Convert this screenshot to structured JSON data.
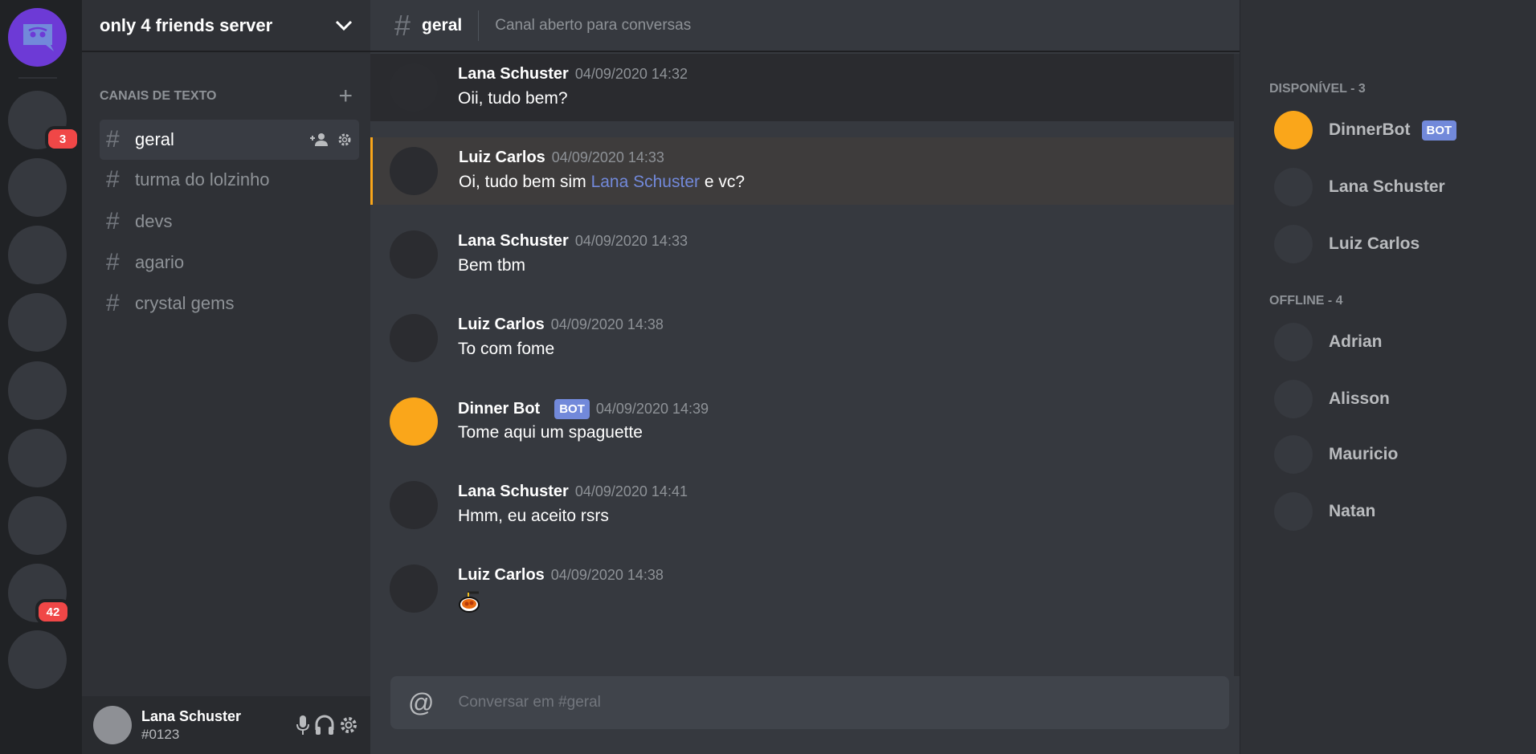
{
  "rail": {
    "badges": {
      "server1": "3",
      "server8": "42"
    }
  },
  "sidebar": {
    "server_name": "only 4 friends server",
    "category": "CANAIS DE TEXTO",
    "channels": [
      {
        "name": "geral"
      },
      {
        "name": "turma do lolzinho"
      },
      {
        "name": "devs"
      },
      {
        "name": "agario"
      },
      {
        "name": "crystal gems"
      }
    ]
  },
  "user": {
    "name": "Lana Schuster",
    "tag": "#0123"
  },
  "chat": {
    "channel": "geral",
    "topic": "Canal aberto para conversas",
    "input_placeholder": "Conversar em #geral",
    "messages": [
      {
        "author": "Lana Schuster",
        "time": "04/09/2020 14:32",
        "text": "Oii, tudo bem?"
      },
      {
        "author": "Luiz Carlos",
        "time": "04/09/2020 14:33",
        "text": "Oi, tudo bem sim ",
        "mention": "Lana Schuster",
        "text_after": " e vc?"
      },
      {
        "author": "Lana Schuster",
        "time": "04/09/2020 14:33",
        "text": "Bem tbm"
      },
      {
        "author": "Luiz Carlos",
        "time": "04/09/2020 14:38",
        "text": "To com fome"
      },
      {
        "author": "Dinner Bot",
        "bot_label": "BOT",
        "time": "04/09/2020 14:39",
        "text": "Tome aqui um spaguette"
      },
      {
        "author": "Lana Schuster",
        "time": "04/09/2020 14:41",
        "text": "Hmm, eu aceito rsrs"
      },
      {
        "author": "Luiz Carlos",
        "time": "04/09/2020 14:38",
        "emoji": "spaghetti-emoji"
      }
    ]
  },
  "members": {
    "online_header": "DISPONÍVEL - 3",
    "online": [
      {
        "name": "DinnerBot",
        "bot_label": "BOT"
      },
      {
        "name": "Lana Schuster"
      },
      {
        "name": "Luiz Carlos"
      }
    ],
    "offline_header": "OFFLINE - 4",
    "offline": [
      {
        "name": "Adrian"
      },
      {
        "name": "Alisson"
      },
      {
        "name": "Mauricio"
      },
      {
        "name": "Natan"
      }
    ]
  },
  "colors": {
    "accent": "#7289da",
    "bot_avatar": "#faa61a",
    "badge": "#f04747",
    "logo": "#6d3ad6"
  }
}
